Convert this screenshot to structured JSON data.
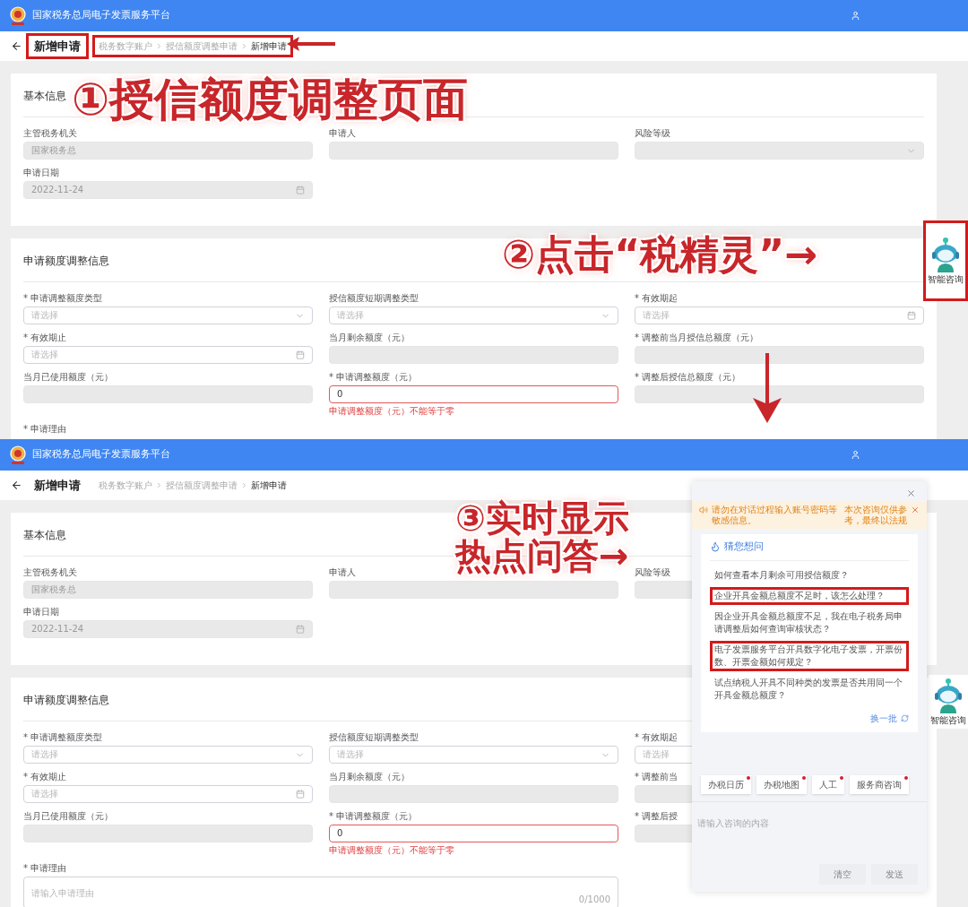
{
  "screens": [
    {
      "header": {
        "title": "国家税务总局电子发票服务平台"
      },
      "page_title": {
        "text": "新增申请",
        "highlighted": true
      },
      "breadcrumb": {
        "highlighted": true,
        "items": [
          {
            "text": "税务数字账户",
            "current": false
          },
          {
            "text": "授信额度调整申请",
            "current": false
          },
          {
            "text": "新增申请",
            "current": true
          }
        ]
      },
      "sections": [
        {
          "title": "基本信息",
          "fields": [
            {
              "label": "主管税务机关",
              "kind": "text",
              "disabled": true,
              "value": "国家税务总"
            },
            {
              "label": "申请人",
              "kind": "text",
              "disabled": true
            },
            {
              "label": "风险等级",
              "kind": "select",
              "disabled": true
            },
            {
              "label": "申请日期",
              "kind": "date",
              "disabled": true,
              "value": "2022-11-24"
            }
          ]
        },
        {
          "title": "申请额度调整信息",
          "fields": [
            {
              "label": "* 申请调整额度类型",
              "kind": "select",
              "disabled": false,
              "placeholder": "请选择"
            },
            {
              "label": "授信额度短期调整类型",
              "kind": "select",
              "disabled": false,
              "placeholder": "请选择"
            },
            {
              "label": "* 有效期起",
              "kind": "date",
              "disabled": false,
              "placeholder": "请选择"
            },
            {
              "label": "* 有效期止",
              "kind": "date",
              "disabled": false,
              "placeholder": "请选择"
            },
            {
              "label": "当月剩余额度（元）",
              "kind": "text",
              "disabled": true
            },
            {
              "label": "* 调整前当月授信总额度（元）",
              "kind": "text",
              "disabled": true
            },
            {
              "label": "当月已使用额度（元）",
              "kind": "text",
              "disabled": true
            },
            {
              "label": "* 申请调整额度（元）",
              "kind": "text",
              "disabled": false,
              "value": "0",
              "error": "申请调整额度（元）不能等于零"
            },
            {
              "label": "* 调整后授信总额度（元）",
              "kind": "text",
              "disabled": true
            },
            {
              "label": "* 申请理由",
              "kind": "textarea"
            }
          ]
        }
      ],
      "assistant": {
        "label": "智能咨询",
        "highlighted": true
      },
      "annotations": [
        {
          "kind": "text",
          "text": "①授信额度调整页面"
        },
        {
          "kind": "arrow-left"
        },
        {
          "kind": "text",
          "text": "②点击“税精灵”→"
        },
        {
          "kind": "arrow-down"
        }
      ]
    },
    {
      "header": {
        "title": "国家税务总局电子发票服务平台"
      },
      "page_title": {
        "text": "新增申请",
        "highlighted": false
      },
      "breadcrumb": {
        "highlighted": false,
        "items": [
          {
            "text": "税务数字账户",
            "current": false
          },
          {
            "text": "授信额度调整申请",
            "current": false
          },
          {
            "text": "新增申请",
            "current": true
          }
        ]
      },
      "sections": [
        {
          "title": "基本信息",
          "fields": [
            {
              "label": "主管税务机关",
              "kind": "text",
              "disabled": true,
              "value": "国家税务总"
            },
            {
              "label": "申请人",
              "kind": "text",
              "disabled": true
            },
            {
              "label": "风险等级",
              "kind": "select",
              "disabled": true
            },
            {
              "label": "申请日期",
              "kind": "date",
              "disabled": true,
              "value": "2022-11-24"
            }
          ]
        },
        {
          "title": "申请额度调整信息",
          "fields": [
            {
              "label": "* 申请调整额度类型",
              "kind": "select",
              "disabled": false,
              "placeholder": "请选择"
            },
            {
              "label": "授信额度短期调整类型",
              "kind": "select",
              "disabled": false,
              "placeholder": "请选择"
            },
            {
              "label": "* 有效期起",
              "kind": "date",
              "disabled": false,
              "placeholder": "请选择"
            },
            {
              "label": "* 有效期止",
              "kind": "date",
              "disabled": false,
              "placeholder": "请选择"
            },
            {
              "label": "当月剩余额度（元）",
              "kind": "text",
              "disabled": true
            },
            {
              "label": "* 调整前当",
              "kind": "text",
              "disabled": true
            },
            {
              "label": "当月已使用额度（元）",
              "kind": "text",
              "disabled": true
            },
            {
              "label": "* 申请调整额度（元）",
              "kind": "text",
              "disabled": false,
              "value": "0",
              "error": "申请调整额度（元）不能等于零"
            },
            {
              "label": "* 调整后授",
              "kind": "text",
              "disabled": true
            },
            {
              "label": "* 申请理由",
              "kind": "textarea",
              "disabled": false,
              "placeholder": "请输入申请理由",
              "counter": "0/1000"
            }
          ]
        }
      ],
      "assistant": {
        "label": "智能咨询",
        "highlighted": false
      },
      "annotations": [
        {
          "kind": "text",
          "text": "③实时显示"
        },
        {
          "kind": "text",
          "text": "热点问答→"
        }
      ],
      "chat": {
        "notice": "请勿在对话过程输入账号密码等敏感信息。",
        "disclaimer": "本次咨询仅供参考，最终以法规",
        "suggest_title": "猜您想问",
        "questions": [
          {
            "text": "如何查看本月剩余可用授信额度？",
            "highlighted": false
          },
          {
            "text": "企业开具金额总额度不足时，该怎么处理？",
            "highlighted": true
          },
          {
            "text": "因企业开具金额总额度不足，我在电子税务局申请调整后如何查询审核状态？",
            "highlighted": false
          },
          {
            "text": "电子发票服务平台开具数字化电子发票，开票份数、开票金额如何规定？",
            "highlighted": true
          },
          {
            "text": "试点纳税人开具不同种类的发票是否共用同一个开具金额总额度？",
            "highlighted": false
          }
        ],
        "refresh": "换一批",
        "shortcuts": [
          {
            "label": "办税日历",
            "badge": true
          },
          {
            "label": "办税地图",
            "badge": true
          },
          {
            "label": "人工",
            "badge": true
          },
          {
            "label": "服务商咨询",
            "badge": true
          }
        ],
        "input_placeholder": "请输入咨询的内容",
        "buttons": [
          "清空",
          "发送"
        ]
      }
    }
  ]
}
